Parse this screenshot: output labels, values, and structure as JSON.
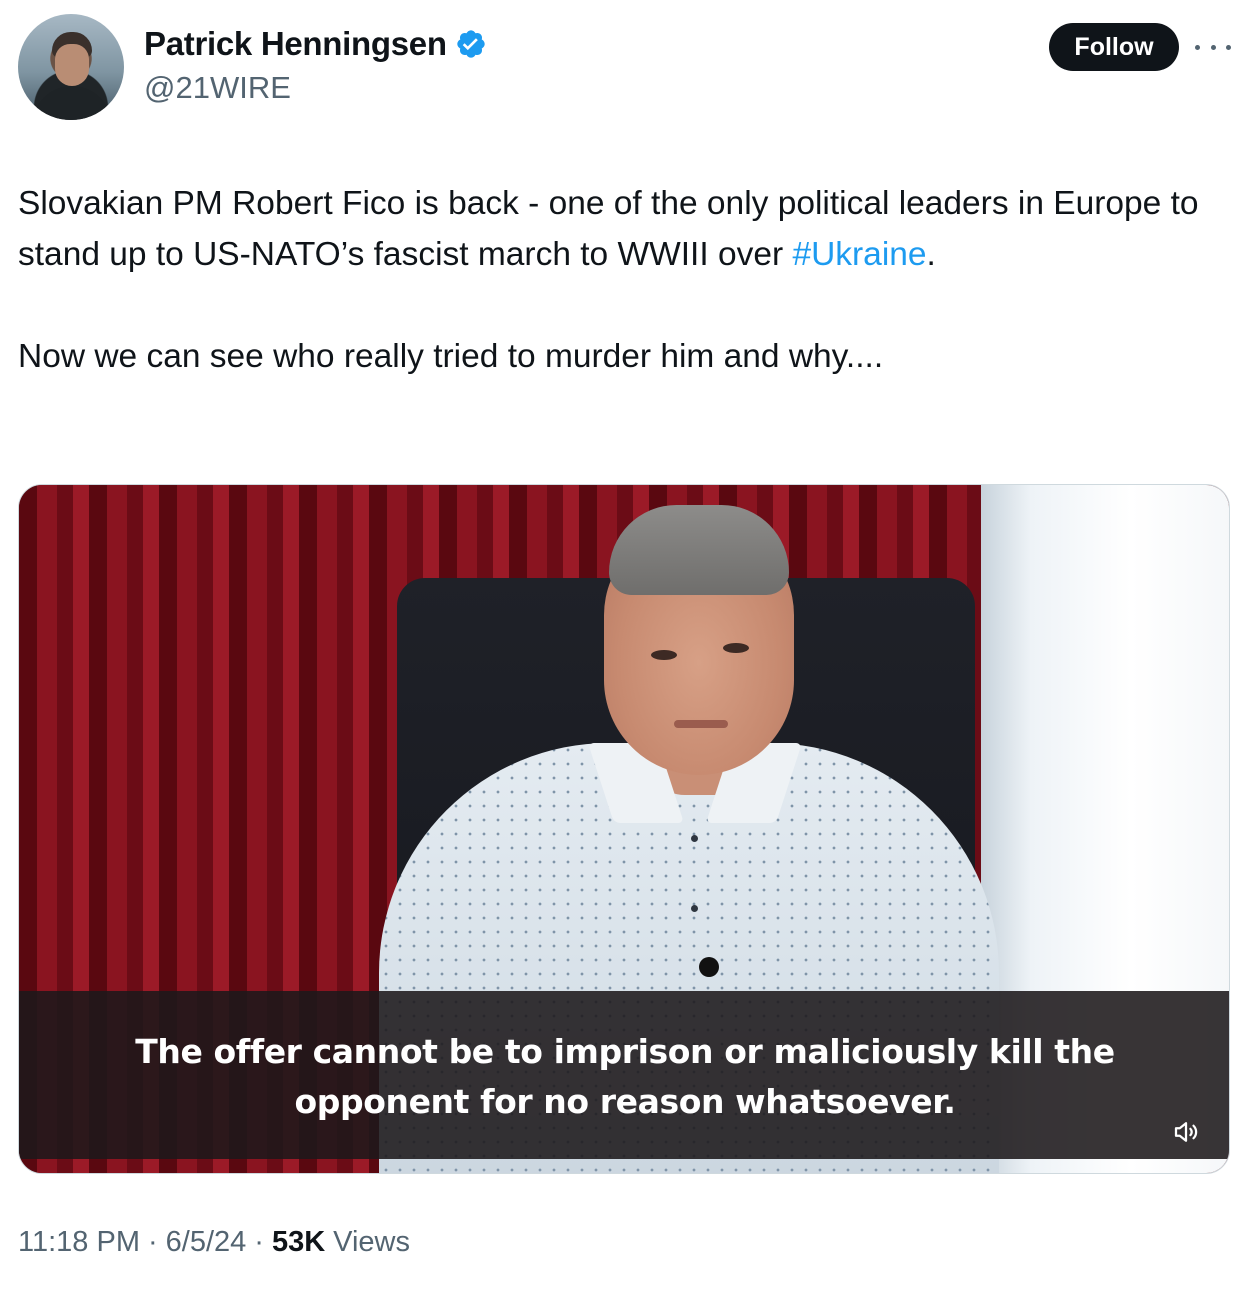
{
  "author": {
    "display_name": "Patrick Henningsen",
    "handle": "@21WIRE",
    "verified": true,
    "avatar_icon": "profile-photo"
  },
  "actions": {
    "follow_label": "Follow",
    "more_icon": "more-horizontal-icon"
  },
  "tweet": {
    "paragraph1_text": "Slovakian PM Robert Fico is back - one of the only political leaders in Europe to stand up to US-NATO’s fascist march to WWIII over ",
    "hashtag": "#Ukraine",
    "paragraph1_end": ".",
    "paragraph2": "Now we can see who really tried to murder him and why...."
  },
  "media": {
    "subtitle_line1": "The offer cannot be to imprison or maliciously kill the",
    "subtitle_line2": "opponent for no reason whatsoever.",
    "sound_icon": "speaker-icon"
  },
  "meta": {
    "time": "11:18 PM",
    "separator": "·",
    "date": "6/5/24",
    "views_count": "53K",
    "views_label": "Views"
  },
  "colors": {
    "link": "#1d9bf0",
    "text": "#0f1419",
    "secondary": "#536471",
    "verified": "#1d9bf0"
  }
}
